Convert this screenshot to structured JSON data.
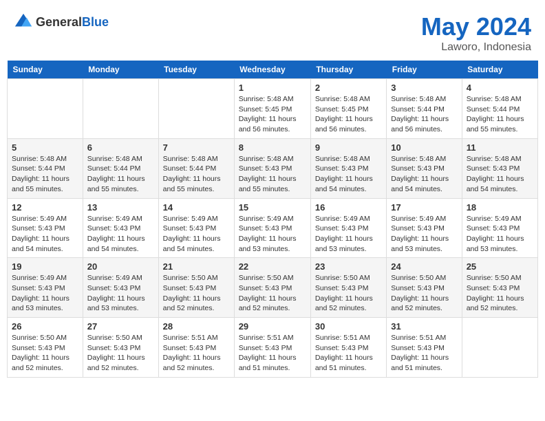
{
  "header": {
    "logo_general": "General",
    "logo_blue": "Blue",
    "month": "May 2024",
    "location": "Laworo, Indonesia"
  },
  "weekdays": [
    "Sunday",
    "Monday",
    "Tuesday",
    "Wednesday",
    "Thursday",
    "Friday",
    "Saturday"
  ],
  "weeks": [
    [
      {
        "date": "",
        "info": ""
      },
      {
        "date": "",
        "info": ""
      },
      {
        "date": "",
        "info": ""
      },
      {
        "date": "1",
        "info": "Sunrise: 5:48 AM\nSunset: 5:45 PM\nDaylight: 11 hours\nand 56 minutes."
      },
      {
        "date": "2",
        "info": "Sunrise: 5:48 AM\nSunset: 5:45 PM\nDaylight: 11 hours\nand 56 minutes."
      },
      {
        "date": "3",
        "info": "Sunrise: 5:48 AM\nSunset: 5:44 PM\nDaylight: 11 hours\nand 56 minutes."
      },
      {
        "date": "4",
        "info": "Sunrise: 5:48 AM\nSunset: 5:44 PM\nDaylight: 11 hours\nand 55 minutes."
      }
    ],
    [
      {
        "date": "5",
        "info": "Sunrise: 5:48 AM\nSunset: 5:44 PM\nDaylight: 11 hours\nand 55 minutes."
      },
      {
        "date": "6",
        "info": "Sunrise: 5:48 AM\nSunset: 5:44 PM\nDaylight: 11 hours\nand 55 minutes."
      },
      {
        "date": "7",
        "info": "Sunrise: 5:48 AM\nSunset: 5:44 PM\nDaylight: 11 hours\nand 55 minutes."
      },
      {
        "date": "8",
        "info": "Sunrise: 5:48 AM\nSunset: 5:43 PM\nDaylight: 11 hours\nand 55 minutes."
      },
      {
        "date": "9",
        "info": "Sunrise: 5:48 AM\nSunset: 5:43 PM\nDaylight: 11 hours\nand 54 minutes."
      },
      {
        "date": "10",
        "info": "Sunrise: 5:48 AM\nSunset: 5:43 PM\nDaylight: 11 hours\nand 54 minutes."
      },
      {
        "date": "11",
        "info": "Sunrise: 5:48 AM\nSunset: 5:43 PM\nDaylight: 11 hours\nand 54 minutes."
      }
    ],
    [
      {
        "date": "12",
        "info": "Sunrise: 5:49 AM\nSunset: 5:43 PM\nDaylight: 11 hours\nand 54 minutes."
      },
      {
        "date": "13",
        "info": "Sunrise: 5:49 AM\nSunset: 5:43 PM\nDaylight: 11 hours\nand 54 minutes."
      },
      {
        "date": "14",
        "info": "Sunrise: 5:49 AM\nSunset: 5:43 PM\nDaylight: 11 hours\nand 54 minutes."
      },
      {
        "date": "15",
        "info": "Sunrise: 5:49 AM\nSunset: 5:43 PM\nDaylight: 11 hours\nand 53 minutes."
      },
      {
        "date": "16",
        "info": "Sunrise: 5:49 AM\nSunset: 5:43 PM\nDaylight: 11 hours\nand 53 minutes."
      },
      {
        "date": "17",
        "info": "Sunrise: 5:49 AM\nSunset: 5:43 PM\nDaylight: 11 hours\nand 53 minutes."
      },
      {
        "date": "18",
        "info": "Sunrise: 5:49 AM\nSunset: 5:43 PM\nDaylight: 11 hours\nand 53 minutes."
      }
    ],
    [
      {
        "date": "19",
        "info": "Sunrise: 5:49 AM\nSunset: 5:43 PM\nDaylight: 11 hours\nand 53 minutes."
      },
      {
        "date": "20",
        "info": "Sunrise: 5:49 AM\nSunset: 5:43 PM\nDaylight: 11 hours\nand 53 minutes."
      },
      {
        "date": "21",
        "info": "Sunrise: 5:50 AM\nSunset: 5:43 PM\nDaylight: 11 hours\nand 52 minutes."
      },
      {
        "date": "22",
        "info": "Sunrise: 5:50 AM\nSunset: 5:43 PM\nDaylight: 11 hours\nand 52 minutes."
      },
      {
        "date": "23",
        "info": "Sunrise: 5:50 AM\nSunset: 5:43 PM\nDaylight: 11 hours\nand 52 minutes."
      },
      {
        "date": "24",
        "info": "Sunrise: 5:50 AM\nSunset: 5:43 PM\nDaylight: 11 hours\nand 52 minutes."
      },
      {
        "date": "25",
        "info": "Sunrise: 5:50 AM\nSunset: 5:43 PM\nDaylight: 11 hours\nand 52 minutes."
      }
    ],
    [
      {
        "date": "26",
        "info": "Sunrise: 5:50 AM\nSunset: 5:43 PM\nDaylight: 11 hours\nand 52 minutes."
      },
      {
        "date": "27",
        "info": "Sunrise: 5:50 AM\nSunset: 5:43 PM\nDaylight: 11 hours\nand 52 minutes."
      },
      {
        "date": "28",
        "info": "Sunrise: 5:51 AM\nSunset: 5:43 PM\nDaylight: 11 hours\nand 52 minutes."
      },
      {
        "date": "29",
        "info": "Sunrise: 5:51 AM\nSunset: 5:43 PM\nDaylight: 11 hours\nand 51 minutes."
      },
      {
        "date": "30",
        "info": "Sunrise: 5:51 AM\nSunset: 5:43 PM\nDaylight: 11 hours\nand 51 minutes."
      },
      {
        "date": "31",
        "info": "Sunrise: 5:51 AM\nSunset: 5:43 PM\nDaylight: 11 hours\nand 51 minutes."
      },
      {
        "date": "",
        "info": ""
      }
    ]
  ]
}
